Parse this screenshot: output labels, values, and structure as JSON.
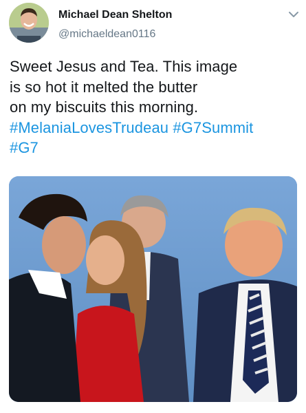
{
  "tweet": {
    "author": {
      "display_name": "Michael Dean Shelton",
      "handle": "@michaeldean0116",
      "avatar_icon": "profile-avatar"
    },
    "menu_icon": "chevron-down-icon",
    "text_lines": [
      "Sweet Jesus and Tea. This image",
      "is so hot it melted the butter",
      "on my biscuits this morning."
    ],
    "hashtags": [
      "#MelaniaLovesTrudeau",
      "#G7Summit",
      "#G7"
    ],
    "link_color": "#1b95e0",
    "media": {
      "type": "photo",
      "sky_color": "#6b9ad0"
    }
  }
}
